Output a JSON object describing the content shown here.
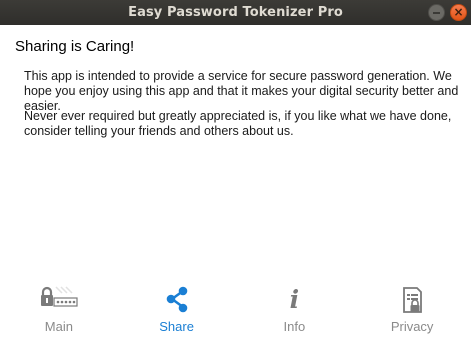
{
  "window": {
    "title": "Easy Password Tokenizer Pro",
    "close_glyph": "×"
  },
  "main": {
    "heading": "Sharing is Caring!",
    "paragraph1": "This app is intended to provide a service for secure password generation. We hope you enjoy using this app and that it makes your digital security better and easier.",
    "paragraph2": "Never ever required but greatly appreciated is, if you like what we have done, consider telling your friends and others about us."
  },
  "tabs": [
    {
      "label": "Main",
      "icon": "lock-password-icon",
      "active": false
    },
    {
      "label": "Share",
      "icon": "share-icon",
      "active": true
    },
    {
      "label": "Info",
      "icon": "info-icon",
      "active": false,
      "glyph": "i"
    },
    {
      "label": "Privacy",
      "icon": "privacy-document-lock-icon",
      "active": false
    }
  ],
  "colors": {
    "titlebar": "#3c3b37",
    "title_text": "#dfdbd2",
    "close_button": "#e25416",
    "active_tab": "#1a7fd4",
    "inactive_tab": "#8a8a8a"
  }
}
